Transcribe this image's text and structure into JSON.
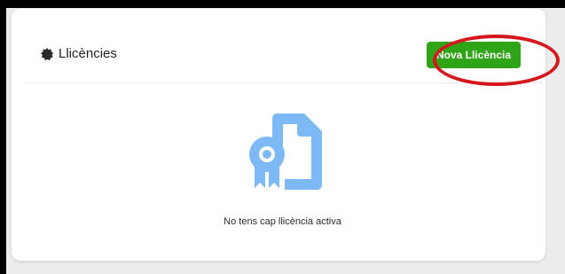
{
  "card": {
    "title": "Llicències",
    "title_icon": "badge-icon",
    "new_button_label": "Nova Llicència",
    "highlight_color": "#d6161d",
    "button_color": "#2ea416"
  },
  "empty_state": {
    "icon": "license-document-icon",
    "message": "No tens cap llicència activa",
    "icon_color": "#7db9f5"
  }
}
